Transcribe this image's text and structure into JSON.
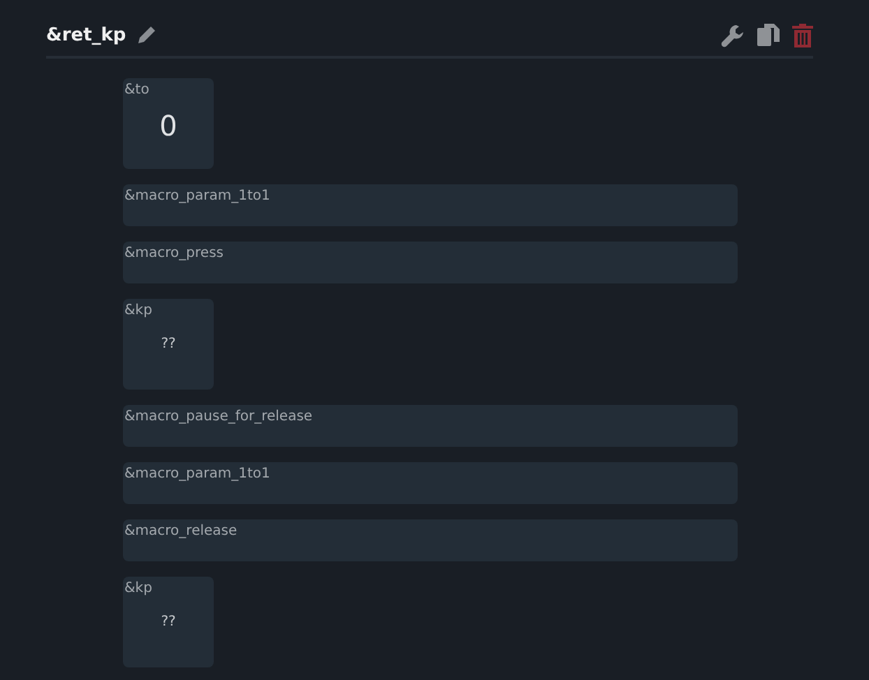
{
  "header": {
    "title": "&ret_kp"
  },
  "bindings": [
    {
      "kind": "param",
      "label": "&to",
      "value": "0"
    },
    {
      "kind": "macro",
      "label": "&macro_param_1to1"
    },
    {
      "kind": "macro",
      "label": "&macro_press"
    },
    {
      "kind": "key",
      "label": "&kp",
      "value": "??"
    },
    {
      "kind": "macro",
      "label": "&macro_pause_for_release"
    },
    {
      "kind": "macro",
      "label": "&macro_param_1to1"
    },
    {
      "kind": "macro",
      "label": "&macro_release"
    },
    {
      "kind": "key",
      "label": "&kp",
      "value": "??"
    }
  ]
}
